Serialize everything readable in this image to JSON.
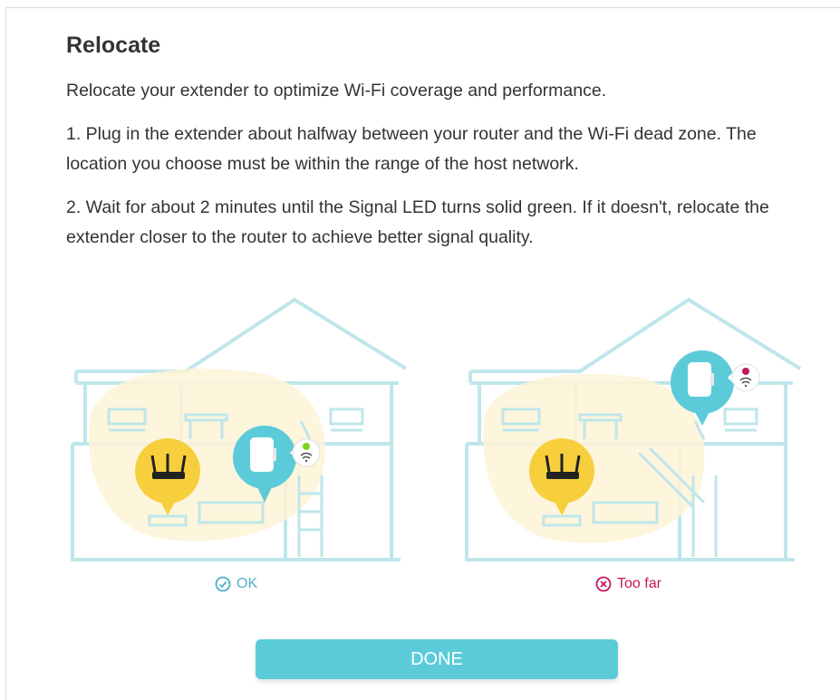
{
  "dialog": {
    "title": "Relocate",
    "intro": "Relocate your extender to optimize Wi-Fi coverage and performance.",
    "step1": "1. Plug in the extender about halfway between your router and the Wi-Fi dead zone. The location you choose must be within the range of the host network.",
    "step2": "2. Wait for about 2 minutes until the Signal LED turns solid green. If it doesn't, relocate the extender closer to the router to achieve better signal quality.",
    "status_ok": "OK",
    "status_far": "Too far",
    "done_label": "DONE"
  },
  "colors": {
    "house_outline": "#bfe6ea",
    "coverage": "#fdf3d6",
    "router_badge": "#f7cf3d",
    "extender_badge": "#5ccbd9",
    "led_green": "#7ed321",
    "led_red": "#c2185b",
    "ok": "#4fb0c6",
    "far": "#c2185b",
    "button": "#5ccbd9"
  },
  "icons": [
    "router-icon",
    "extender-icon",
    "wifi-icon",
    "check-circle-icon",
    "x-circle-icon"
  ]
}
